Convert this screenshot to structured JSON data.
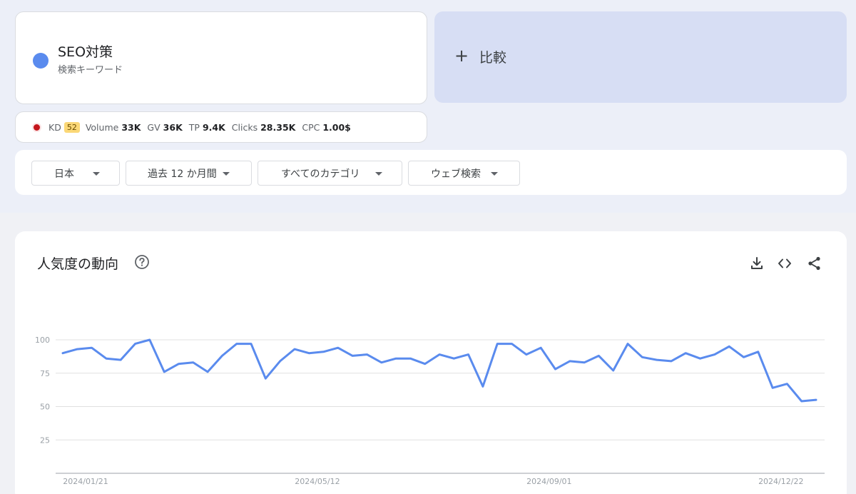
{
  "term": {
    "name": "SEO対策",
    "subtitle": "検索キーワード",
    "color": "#5a8bee"
  },
  "compare": {
    "plus": "+",
    "label": "比較"
  },
  "metrics": [
    {
      "label": "KD",
      "value": "52",
      "badge": true
    },
    {
      "label": "Volume",
      "value": "33K"
    },
    {
      "label": "GV",
      "value": "36K"
    },
    {
      "label": "TP",
      "value": "9.4K"
    },
    {
      "label": "Clicks",
      "value": "28.35K"
    },
    {
      "label": "CPC",
      "value": "1.00$"
    }
  ],
  "filters": {
    "region": "日本",
    "period": "過去 12 か月間",
    "category": "すべてのカテゴリ",
    "search_type": "ウェブ検索"
  },
  "chart_header": {
    "title": "人気度の動向",
    "icons": [
      "help-icon",
      "download-icon",
      "embed-code-icon",
      "share-icon"
    ]
  },
  "chart_data": {
    "type": "line",
    "x_tick_labels": [
      "2024/01/21",
      "2024/05/12",
      "2024/09/01",
      "2024/12/22"
    ],
    "x_tick_indices": [
      0,
      16,
      32,
      48
    ],
    "y_ticks": [
      25,
      50,
      75,
      100
    ],
    "ylim": [
      0,
      100
    ],
    "grid": true,
    "series": [
      {
        "color": "#5a8bee",
        "values": [
          90,
          93,
          94,
          86,
          85,
          97,
          100,
          76,
          82,
          83,
          76,
          88,
          97,
          97,
          71,
          84,
          93,
          90,
          91,
          94,
          88,
          89,
          83,
          86,
          86,
          82,
          89,
          86,
          89,
          65,
          97,
          97,
          89,
          94,
          78,
          84,
          83,
          88,
          77,
          97,
          87,
          85,
          84,
          90,
          86,
          89,
          95,
          87,
          91,
          64,
          67,
          54,
          55
        ]
      }
    ]
  }
}
